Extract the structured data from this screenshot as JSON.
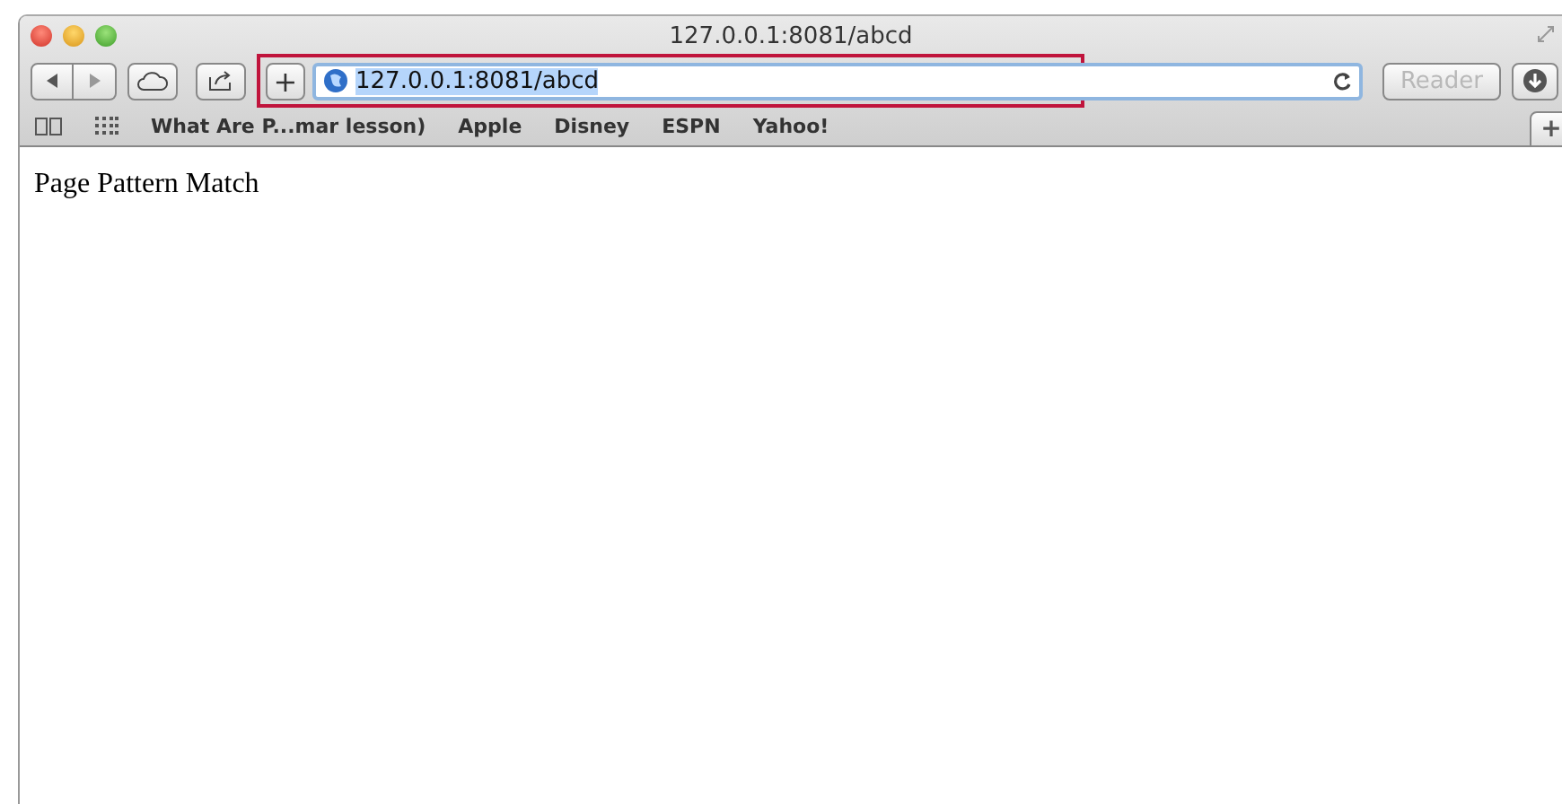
{
  "window": {
    "title": "127.0.0.1:8081/abcd"
  },
  "toolbar": {
    "add_button": "+",
    "address": {
      "value": "127.0.0.1:8081/abcd",
      "text_selected": true,
      "highlighted": true
    },
    "reader_button": {
      "label": "Reader",
      "disabled": true
    }
  },
  "bookmarks": [
    "What Are P...mar lesson)",
    "Apple",
    "Disney",
    "ESPN",
    "Yahoo!"
  ],
  "new_tab_button": "+",
  "content": {
    "text": "Page Pattern Match"
  }
}
